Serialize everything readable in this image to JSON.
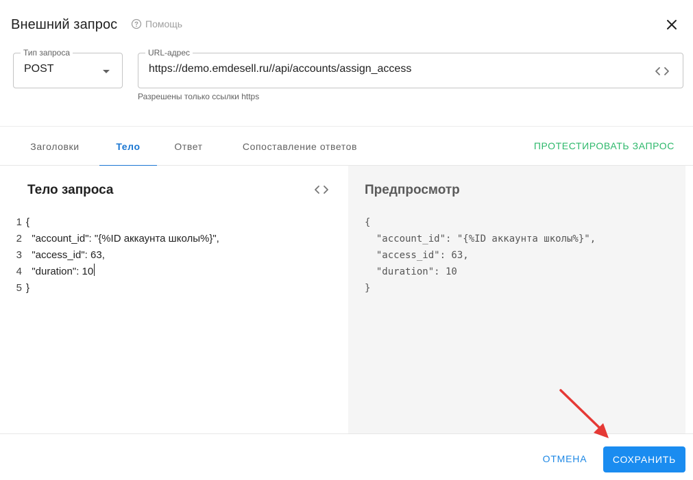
{
  "dialog": {
    "title": "Внешний запрос",
    "help_label": "Помощь"
  },
  "request": {
    "method_label": "Тип запроса",
    "method_value": "POST",
    "url_label": "URL-адрес",
    "url_value": "https://demo.emdesell.ru//api/accounts/assign_access",
    "url_hint": "Разрешены только ссылки https"
  },
  "tabs": [
    {
      "label": "Заголовки",
      "active": false
    },
    {
      "label": "Тело",
      "active": true
    },
    {
      "label": "Ответ",
      "active": false
    },
    {
      "label": "Сопоставление ответов",
      "active": false
    }
  ],
  "test_button": "ПРОТЕСТИРОВАТЬ ЗАПРОС",
  "editor": {
    "title": "Тело запроса",
    "lines": [
      {
        "num": "1",
        "text": "{"
      },
      {
        "num": "2",
        "text": "  \"account_id\": \"{%ID аккаунта школы%}\","
      },
      {
        "num": "3",
        "text": "  \"access_id\": 63,"
      },
      {
        "num": "4",
        "text": "  \"duration\": 10"
      },
      {
        "num": "5",
        "text": "}"
      }
    ]
  },
  "preview": {
    "title": "Предпросмотр",
    "lines": [
      "{",
      "  \"account_id\": \"{%ID аккаунта школы%}\",",
      "  \"access_id\": 63,",
      "  \"duration\": 10",
      "}"
    ]
  },
  "footer": {
    "cancel_label": "ОТМЕНА",
    "save_label": "СОХРАНИТЬ"
  },
  "colors": {
    "accent": "#1976d2",
    "save_bg": "#1a8cf0",
    "test_green": "#2db86b",
    "arrow_red": "#e53935"
  },
  "icons": [
    "help-circle-icon",
    "close-icon",
    "dropdown-caret-icon",
    "code-toggle-icon",
    "annotation-arrow-icon"
  ]
}
